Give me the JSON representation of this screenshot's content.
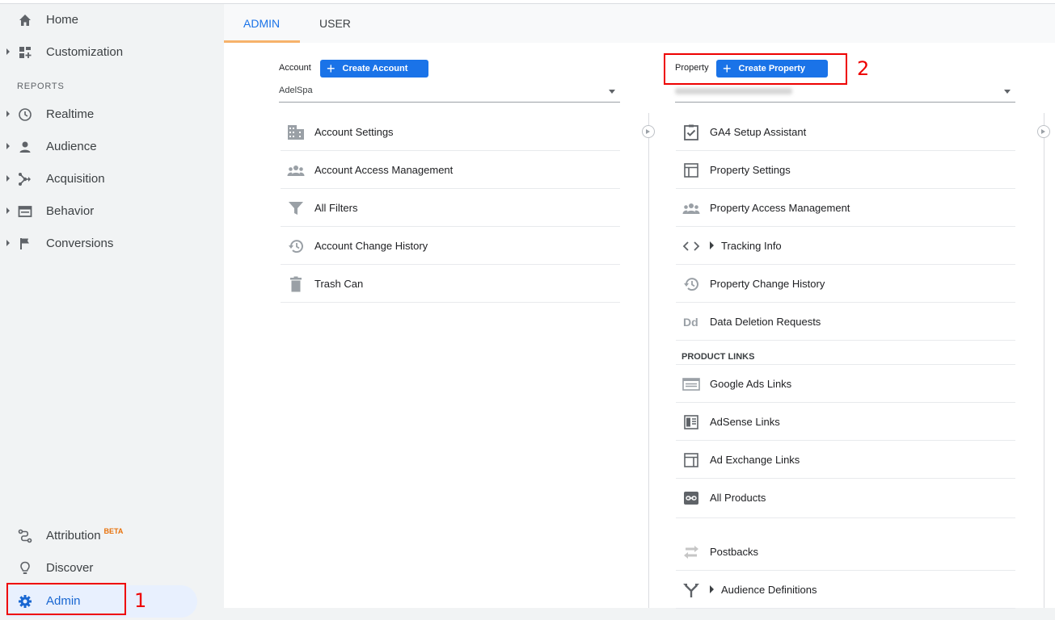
{
  "sidebar": {
    "home": "Home",
    "customization": "Customization",
    "reports_header": "REPORTS",
    "realtime": "Realtime",
    "audience": "Audience",
    "acquisition": "Acquisition",
    "behavior": "Behavior",
    "conversions": "Conversions",
    "attribution": "Attribution",
    "attribution_badge": "BETA",
    "discover": "Discover",
    "admin": "Admin"
  },
  "tabs": {
    "admin": "ADMIN",
    "user": "USER"
  },
  "account": {
    "label": "Account",
    "create_button": "Create Account",
    "selected": "AdelSpa",
    "items": [
      {
        "label": "Account Settings",
        "icon": "building-icon"
      },
      {
        "label": "Account Access Management",
        "icon": "people-icon"
      },
      {
        "label": "All Filters",
        "icon": "filter-icon"
      },
      {
        "label": "Account Change History",
        "icon": "history-icon"
      },
      {
        "label": "Trash Can",
        "icon": "trash-icon"
      }
    ]
  },
  "property": {
    "label": "Property",
    "create_button": "Create Property",
    "items": [
      {
        "label": "GA4 Setup Assistant",
        "icon": "checklist-icon"
      },
      {
        "label": "Property Settings",
        "icon": "layout-icon"
      },
      {
        "label": "Property Access Management",
        "icon": "people-icon"
      },
      {
        "label": "Tracking Info",
        "icon": "code-icon"
      },
      {
        "label": "Property Change History",
        "icon": "history-icon"
      },
      {
        "label": "Data Deletion Requests",
        "icon": "dd-icon"
      }
    ],
    "product_links_header": "PRODUCT LINKS",
    "links": [
      {
        "label": "Google Ads Links",
        "icon": "ads-icon"
      },
      {
        "label": "AdSense Links",
        "icon": "adsense-icon"
      },
      {
        "label": "Ad Exchange Links",
        "icon": "adexchange-icon"
      },
      {
        "label": "All Products",
        "icon": "link-icon"
      }
    ],
    "extra": [
      {
        "label": "Postbacks",
        "icon": "postbacks-icon"
      },
      {
        "label": "Audience Definitions",
        "icon": "fork-icon"
      }
    ]
  },
  "annotations": {
    "first": "1",
    "second": "2"
  },
  "colors": {
    "accent": "#1a73e8",
    "annotation_red": "#e00000",
    "tab_underline": "#f6b26b"
  }
}
